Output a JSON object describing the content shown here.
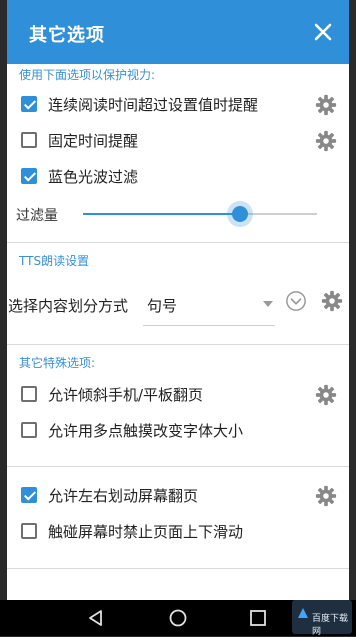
{
  "dialog": {
    "title": "其它选项",
    "close_icon": "close-icon"
  },
  "sections": {
    "protect_eyes": "使用下面选项以保护视力:",
    "tts": "TTS朗读设置",
    "special": "其它特殊选项:"
  },
  "rows": {
    "continuous_read": {
      "label": "连续阅读时间超过设置值时提醒",
      "checked": true
    },
    "fixed_time": {
      "label": "固定时间提醒",
      "checked": false
    },
    "blue_light": {
      "label": "蓝色光波过滤",
      "checked": true
    },
    "tilt_flip": {
      "label": "允许倾斜手机/平板翻页",
      "checked": false
    },
    "multitouch_font": {
      "label": "允许用多点触摸改变字体大小",
      "checked": false
    },
    "swipe_flip": {
      "label": "允许左右划动屏幕翻页",
      "checked": true
    },
    "disable_scroll": {
      "label": "触碰屏幕时禁止页面上下滑动",
      "checked": false
    }
  },
  "filter": {
    "label": "过滤量",
    "value_fraction": 0.67
  },
  "tts_split": {
    "label": "选择内容划分方式",
    "value": "句号"
  },
  "navbar": {
    "back_icon": "back-icon",
    "home_icon": "home-icon",
    "recents_icon": "recents-icon"
  },
  "watermark": {
    "text": "百度下载网"
  },
  "colors": {
    "accent": "#2f8fd8",
    "section_text": "#3b8fd3",
    "navbar": "#000000"
  }
}
